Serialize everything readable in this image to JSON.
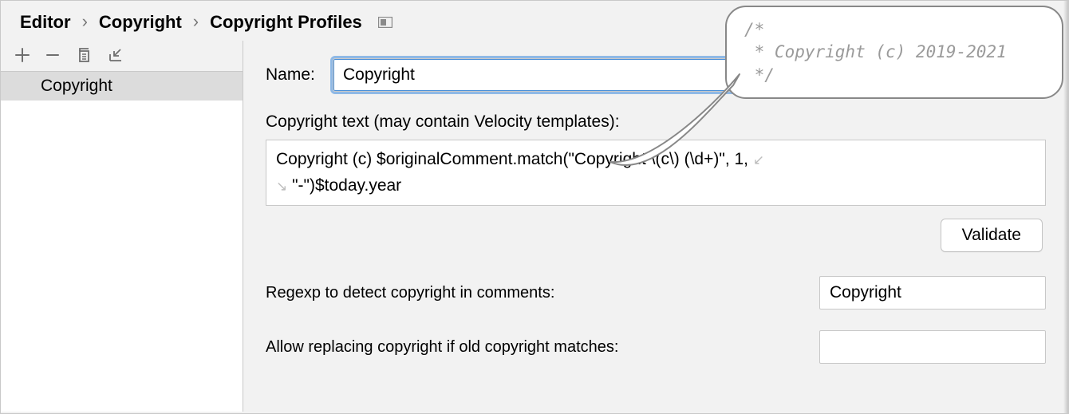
{
  "breadcrumb": {
    "a": "Editor",
    "b": "Copyright",
    "c": "Copyright Profiles"
  },
  "sidebar": {
    "items": [
      {
        "label": "Copyright"
      }
    ]
  },
  "form": {
    "name_label": "Name:",
    "name_value": "Copyright",
    "copyright_text_label": "Copyright text (may contain Velocity templates):",
    "copyright_text_line1": "Copyright (c) $originalComment.match(\"Copyright \\(c\\) (\\d+)\", 1,",
    "copyright_text_line2": "\"-\")$today.year",
    "validate_label": "Validate",
    "regexp_label": "Regexp to detect copyright in comments:",
    "regexp_value": "Copyright",
    "allow_replace_label": "Allow replacing copyright if old copyright matches:",
    "allow_replace_value": ""
  },
  "callout": {
    "line1": "/*",
    "line2": " * Copyright (c) 2019-2021",
    "line3": " */"
  }
}
